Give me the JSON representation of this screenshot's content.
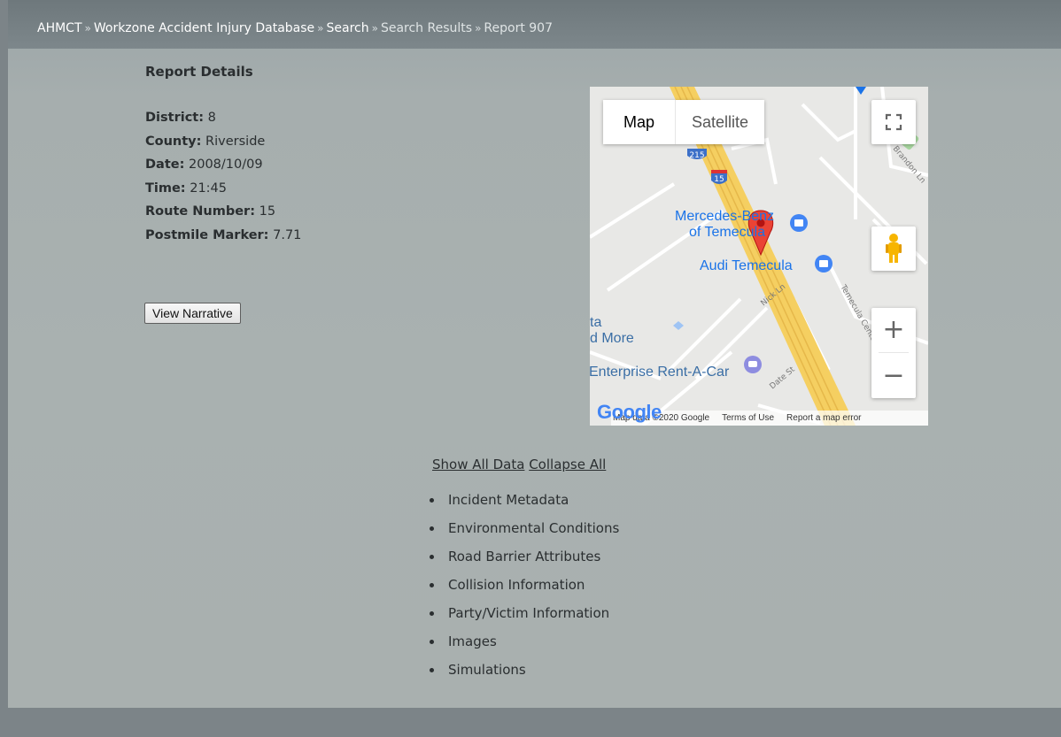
{
  "breadcrumb": {
    "items": [
      "AHMCT",
      "Workzone Accident Injury Database",
      "Search",
      "Search Results",
      "Report 907"
    ],
    "separator": "»"
  },
  "details": {
    "heading": "Report Details",
    "fields": [
      {
        "label": "District:",
        "value": "8"
      },
      {
        "label": "County:",
        "value": "Riverside"
      },
      {
        "label": "Date:",
        "value": "2008/10/09"
      },
      {
        "label": "Time:",
        "value": "21:45"
      },
      {
        "label": "Route Number:",
        "value": "15"
      },
      {
        "label": "Postmile Marker:",
        "value": "7.71"
      }
    ],
    "narrative_button": "View Narrative"
  },
  "map": {
    "type_options": [
      "Map",
      "Satellite"
    ],
    "active_type": "Map",
    "zoom_in": "+",
    "zoom_out": "−",
    "labels": {
      "mercedes": "Mercedes-Benz",
      "mercedes_2": "of Temecula",
      "audi": "Audi Temecula",
      "enterprise": "Enterprise Rent-A-Car",
      "more_1": "ta",
      "more_2": "d More",
      "nick_ln": "Nick Ln",
      "date_st": "Date St",
      "temecula_center": "Temecula Center Dr",
      "brandon": "Brandon Ln",
      "route_215": "215",
      "route_15": "15"
    },
    "footer": {
      "attribution": "Map data ©2020 Google",
      "terms": "Terms of Use",
      "report": "Report a map error"
    },
    "logo": "Google",
    "colors": {
      "highway": "#f5cf61",
      "marker": "#ea4335",
      "poi": "#1a73e8"
    }
  },
  "toggles": {
    "show_all": "Show All Data",
    "collapse_all": "Collapse All"
  },
  "sections": [
    "Incident Metadata",
    "Environmental Conditions",
    "Road Barrier Attributes",
    "Collision Information",
    "Party/Victim Information",
    "Images",
    "Simulations"
  ]
}
